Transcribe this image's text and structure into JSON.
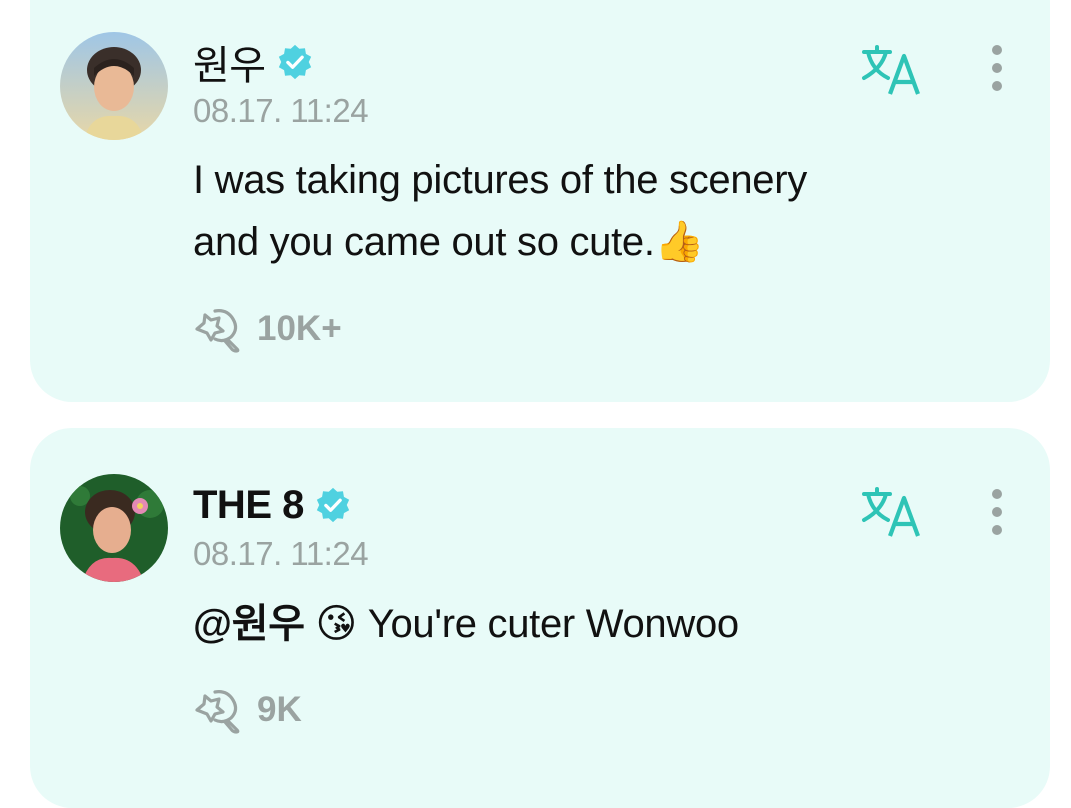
{
  "posts": [
    {
      "author": "원우",
      "timestamp": "08.17. 11:24",
      "text_line1": "I was taking pictures of the scenery",
      "text_line2": "and you came out so cute.",
      "text_emoji": "👍",
      "reaction_count": "10K+"
    },
    {
      "author": "THE 8",
      "timestamp": "08.17. 11:24",
      "mention": "@원우",
      "text_emoji": "😘",
      "text": "You're cuter Wonwoo",
      "reaction_count": "9K"
    }
  ],
  "colors": {
    "card_background": "#e8fbf8",
    "accent": "#2ec4b6",
    "verified_badge": "#4fd1e0",
    "muted_text": "#9aa3a1"
  },
  "icons": [
    "verified-badge-icon",
    "translate-icon",
    "more-options-icon",
    "reaction-icon"
  ]
}
